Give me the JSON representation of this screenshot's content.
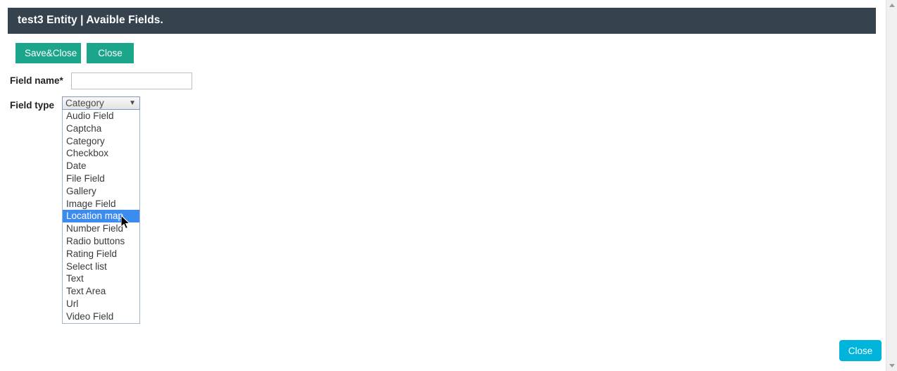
{
  "header": {
    "title": "test3 Entity | Avaible Fields."
  },
  "toolbar": {
    "save_close_label": "Save&Close",
    "close_label": "Close"
  },
  "form": {
    "field_name": {
      "label": "Field name*",
      "value": "",
      "placeholder": ""
    },
    "field_type": {
      "label": "Field type",
      "selected": "Category",
      "arrow_glyph": "▼",
      "highlighted": "Location map",
      "options": [
        "Audio Field",
        "Captcha",
        "Category",
        "Checkbox",
        "Date",
        "File Field",
        "Gallery",
        "Image Field",
        "Location map",
        "Number Field",
        "Radio buttons",
        "Rating Field",
        "Select list",
        "Text",
        "Text Area",
        "Url",
        "Video Field"
      ]
    }
  },
  "footer": {
    "close_label": "Close"
  },
  "colors": {
    "header_bg": "#36434f",
    "toolbar_button_bg": "#1ba68c",
    "footer_button_bg": "#00b4dc",
    "option_highlight_bg": "#3c8cf0",
    "page_bg": "#ffffff"
  },
  "icons": {
    "scroll_up": "scroll-up-arrow-icon",
    "scroll_down": "scroll-down-arrow-icon",
    "mouse_pointer": "mouse-pointer-icon",
    "select_chevron": "chevron-down-icon"
  }
}
